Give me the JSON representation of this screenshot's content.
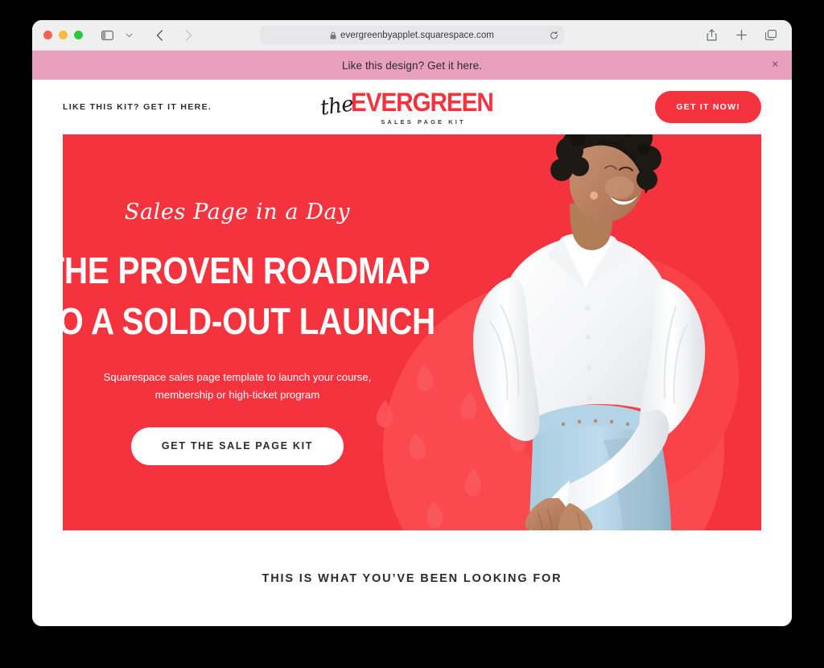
{
  "browser": {
    "url": "evergreenbyapplet.squarespace.com",
    "lock_icon": "lock-icon",
    "reload_icon": "reload-icon",
    "sidebar_icon": "sidebar-toggle-icon",
    "chevron_icon": "chevron-down-icon",
    "back_icon": "back-arrow-icon",
    "forward_icon": "forward-arrow-icon",
    "share_icon": "share-icon",
    "new_tab_icon": "plus-icon",
    "tabs_icon": "tab-overview-icon",
    "traffic_lights": [
      "close",
      "minimize",
      "maximize"
    ]
  },
  "announcement": {
    "text": "Like this design? Get it here.",
    "close_label": "✕",
    "background": "#e8a0be"
  },
  "header": {
    "tagline": "LIKE THIS KIT? GET IT HERE.",
    "logo": {
      "script": "the",
      "main": "EVERGREEN",
      "subtitle": "SALES PAGE KIT",
      "accent_color": "#f5333f"
    },
    "cta_label": "GET IT NOW!"
  },
  "hero": {
    "background": "#f5333f",
    "eyebrow": "Sales Page in a Day",
    "headline_line1": "THE PROVEN ROADMAP",
    "headline_line2": "TO A SOLD-OUT LAUNCH",
    "subtext": "Squarespace sales page template to launch your course, membership or high-ticket program",
    "cta_label": "GET THE SALE PAGE KIT",
    "image_alt": "smiling-woman-white-blouse-photo"
  },
  "section_below": {
    "title": "THIS IS WHAT YOU’VE BEEN LOOKING FOR"
  }
}
